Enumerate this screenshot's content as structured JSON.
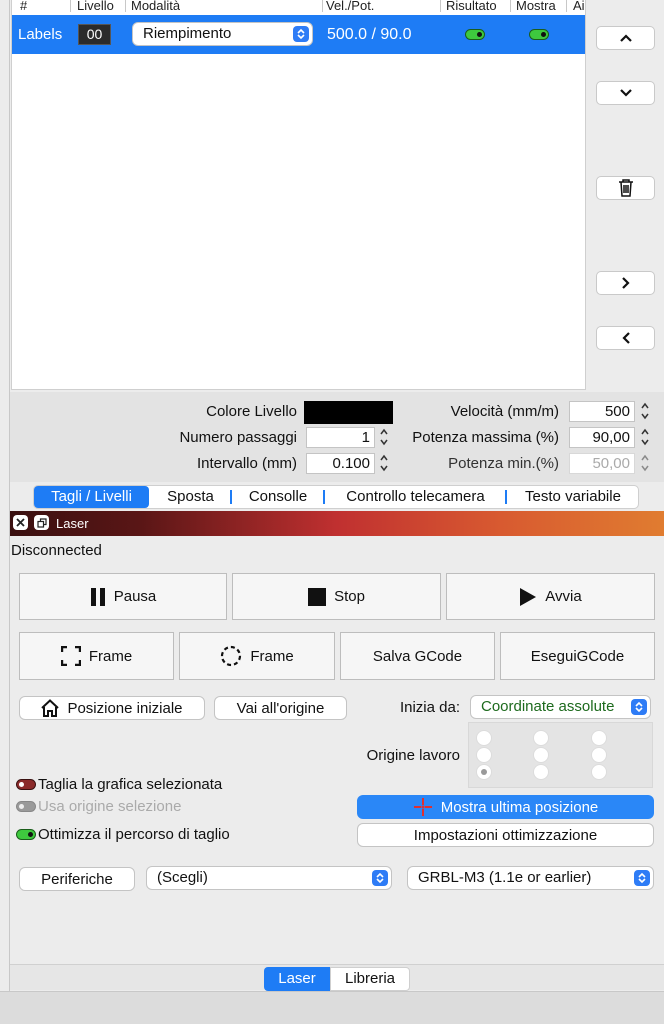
{
  "table": {
    "headers": [
      "#",
      "Livello",
      "Modalità",
      "Vel./Pot.",
      "Risultato",
      "Mostra",
      "Ai"
    ],
    "row": {
      "name": "Labels",
      "level": "00",
      "mode": "Riempimento",
      "speed_power": "500.0 / 90.0",
      "result_on": true,
      "show_on": true
    }
  },
  "side_buttons": [
    "chevron-up-icon",
    "chevron-down-icon",
    "trash-icon",
    "chevron-right-icon",
    "chevron-left-icon"
  ],
  "layer_settings": {
    "color_label": "Colore Livello",
    "color_value": "#000000",
    "passes_label": "Numero passaggi",
    "passes_value": "1",
    "interval_label": "Intervallo (mm)",
    "interval_value": "0.100",
    "speed_label": "Velocità (mm/m)",
    "speed_value": "500",
    "max_power_label": "Potenza massima (%)",
    "max_power_value": "90,00",
    "min_power_label": "Potenza min.(%)",
    "min_power_value": "50,00"
  },
  "top_tabs": [
    "Tagli / Livelli",
    "Sposta",
    "Consolle",
    "Controllo telecamera",
    "Testo variabile"
  ],
  "laser_panel": {
    "title": "Laser",
    "status": "Disconnected",
    "pause": "Pausa",
    "stop": "Stop",
    "start": "Avvia",
    "frame1": "Frame",
    "frame2": "Frame",
    "save_gcode": "Salva GCode",
    "run_gcode": "EseguiGCode",
    "home": "Posizione iniziale",
    "go_origin": "Vai all'origine",
    "start_from_label": "Inizia da:",
    "start_from_value": "Coordinate assolute",
    "job_origin_label": "Origine lavoro",
    "cut_selected": "Taglia la grafica selezionata",
    "use_selection_origin": "Usa origine selezione",
    "optimize_path": "Ottimizza il percorso di taglio",
    "show_last_position": "Mostra ultima posizione",
    "optimization_settings": "Impostazioni ottimizzazione",
    "devices": "Periferiche",
    "device_select": "(Scegli)",
    "firmware_select": "GRBL-M3 (1.1e or earlier)"
  },
  "bottom_tabs": [
    "Laser",
    "Libreria"
  ],
  "colors": {
    "accent": "#1e7cf5",
    "toggle_green": "#3ec93e",
    "title_bar_start": "#3a1010",
    "title_bar_end": "#e07c30"
  }
}
